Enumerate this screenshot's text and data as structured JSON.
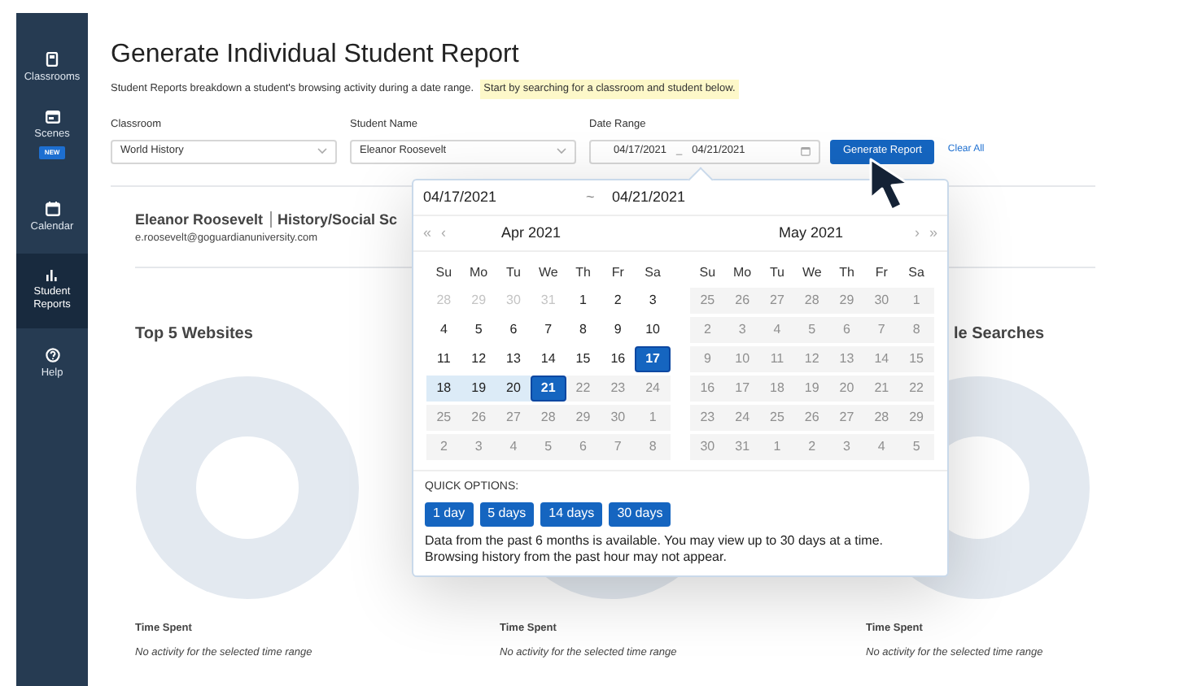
{
  "sidebar": {
    "items": [
      {
        "label": "Classrooms",
        "selected": false
      },
      {
        "label": "Scenes",
        "selected": false,
        "badge": "NEW"
      },
      {
        "label": "Calendar",
        "selected": false
      },
      {
        "label": "Student Reports",
        "selected": true
      },
      {
        "label": "Help",
        "selected": false
      }
    ]
  },
  "page": {
    "title": "Generate Individual Student Report",
    "description": "Student Reports breakdown a student's browsing activity during a date range.",
    "hint": "Start by searching for a classroom and student below."
  },
  "filters": {
    "classroom": {
      "label": "Classroom",
      "value": "World History"
    },
    "student": {
      "label": "Student Name",
      "value": "Eleanor Roosevelt"
    },
    "date_range": {
      "label": "Date Range",
      "start": "04/17/2021",
      "separator": "_",
      "end": "04/21/2021"
    },
    "generate_button": "Generate Report",
    "clear_link": "Clear All"
  },
  "student": {
    "name": "Eleanor Roosevelt",
    "subject": "History/Social Sc",
    "email": "e.roosevelt@goguardianuniversity.com"
  },
  "panels": [
    {
      "title": "Top 5 Websites",
      "metric": "Time Spent",
      "empty": "No activity for the selected time range"
    },
    {
      "metric": "Time Spent",
      "empty": "No activity for the selected time range"
    },
    {
      "title": "le Searches",
      "metric": "Time Spent",
      "empty": "No activity for the selected time range"
    }
  ],
  "date_picker": {
    "start": "04/17/2021",
    "separator": "~",
    "end": "04/21/2021",
    "nav_prev_year": "«",
    "nav_prev": "‹",
    "nav_next": "›",
    "nav_next_year": "»",
    "months": [
      {
        "title": "Apr 2021",
        "weekdays": [
          "Su",
          "Mo",
          "Tu",
          "We",
          "Th",
          "Fr",
          "Sa"
        ],
        "weeks": [
          [
            {
              "day": "28",
              "kind": "outside"
            },
            {
              "day": "29",
              "kind": "outside"
            },
            {
              "day": "30",
              "kind": "outside"
            },
            {
              "day": "31",
              "kind": "outside"
            },
            {
              "day": "1",
              "kind": "normal"
            },
            {
              "day": "2",
              "kind": "normal"
            },
            {
              "day": "3",
              "kind": "normal"
            }
          ],
          [
            {
              "day": "4",
              "kind": "normal"
            },
            {
              "day": "5",
              "kind": "normal"
            },
            {
              "day": "6",
              "kind": "normal"
            },
            {
              "day": "7",
              "kind": "normal"
            },
            {
              "day": "8",
              "kind": "normal"
            },
            {
              "day": "9",
              "kind": "normal"
            },
            {
              "day": "10",
              "kind": "normal"
            }
          ],
          [
            {
              "day": "11",
              "kind": "normal"
            },
            {
              "day": "12",
              "kind": "normal"
            },
            {
              "day": "13",
              "kind": "normal"
            },
            {
              "day": "14",
              "kind": "normal"
            },
            {
              "day": "15",
              "kind": "normal"
            },
            {
              "day": "16",
              "kind": "normal"
            },
            {
              "day": "17",
              "kind": "selected"
            }
          ],
          [
            {
              "day": "18",
              "kind": "in_range"
            },
            {
              "day": "19",
              "kind": "in_range"
            },
            {
              "day": "20",
              "kind": "in_range"
            },
            {
              "day": "21",
              "kind": "selected"
            },
            {
              "day": "22",
              "kind": "disabled"
            },
            {
              "day": "23",
              "kind": "disabled"
            },
            {
              "day": "24",
              "kind": "disabled"
            }
          ],
          [
            {
              "day": "25",
              "kind": "disabled"
            },
            {
              "day": "26",
              "kind": "disabled"
            },
            {
              "day": "27",
              "kind": "disabled"
            },
            {
              "day": "28",
              "kind": "disabled"
            },
            {
              "day": "29",
              "kind": "disabled"
            },
            {
              "day": "30",
              "kind": "disabled"
            },
            {
              "day": "1",
              "kind": "disabled"
            }
          ],
          [
            {
              "day": "2",
              "kind": "disabled"
            },
            {
              "day": "3",
              "kind": "disabled"
            },
            {
              "day": "4",
              "kind": "disabled"
            },
            {
              "day": "5",
              "kind": "disabled"
            },
            {
              "day": "6",
              "kind": "disabled"
            },
            {
              "day": "7",
              "kind": "disabled"
            },
            {
              "day": "8",
              "kind": "disabled"
            }
          ]
        ]
      },
      {
        "title": "May 2021",
        "weekdays": [
          "Su",
          "Mo",
          "Tu",
          "We",
          "Th",
          "Fr",
          "Sa"
        ],
        "weeks": [
          [
            {
              "day": "25",
              "kind": "disabled"
            },
            {
              "day": "26",
              "kind": "disabled"
            },
            {
              "day": "27",
              "kind": "disabled"
            },
            {
              "day": "28",
              "kind": "disabled"
            },
            {
              "day": "29",
              "kind": "disabled"
            },
            {
              "day": "30",
              "kind": "disabled"
            },
            {
              "day": "1",
              "kind": "disabled"
            }
          ],
          [
            {
              "day": "2",
              "kind": "disabled"
            },
            {
              "day": "3",
              "kind": "disabled"
            },
            {
              "day": "4",
              "kind": "disabled"
            },
            {
              "day": "5",
              "kind": "disabled"
            },
            {
              "day": "6",
              "kind": "disabled"
            },
            {
              "day": "7",
              "kind": "disabled"
            },
            {
              "day": "8",
              "kind": "disabled"
            }
          ],
          [
            {
              "day": "9",
              "kind": "disabled"
            },
            {
              "day": "10",
              "kind": "disabled"
            },
            {
              "day": "11",
              "kind": "disabled"
            },
            {
              "day": "12",
              "kind": "disabled"
            },
            {
              "day": "13",
              "kind": "disabled"
            },
            {
              "day": "14",
              "kind": "disabled"
            },
            {
              "day": "15",
              "kind": "disabled"
            }
          ],
          [
            {
              "day": "16",
              "kind": "disabled"
            },
            {
              "day": "17",
              "kind": "disabled"
            },
            {
              "day": "18",
              "kind": "disabled"
            },
            {
              "day": "19",
              "kind": "disabled"
            },
            {
              "day": "20",
              "kind": "disabled"
            },
            {
              "day": "21",
              "kind": "disabled"
            },
            {
              "day": "22",
              "kind": "disabled"
            }
          ],
          [
            {
              "day": "23",
              "kind": "disabled"
            },
            {
              "day": "24",
              "kind": "disabled"
            },
            {
              "day": "25",
              "kind": "disabled"
            },
            {
              "day": "26",
              "kind": "disabled"
            },
            {
              "day": "27",
              "kind": "disabled"
            },
            {
              "day": "28",
              "kind": "disabled"
            },
            {
              "day": "29",
              "kind": "disabled"
            }
          ],
          [
            {
              "day": "30",
              "kind": "disabled"
            },
            {
              "day": "31",
              "kind": "disabled"
            },
            {
              "day": "1",
              "kind": "disabled"
            },
            {
              "day": "2",
              "kind": "disabled"
            },
            {
              "day": "3",
              "kind": "disabled"
            },
            {
              "day": "4",
              "kind": "disabled"
            },
            {
              "day": "5",
              "kind": "disabled"
            }
          ]
        ]
      }
    ],
    "quick_label": "QUICK OPTIONS:",
    "quick_options": [
      "1 day",
      "5 days",
      "14 days",
      "30 days"
    ],
    "note": "Data from the past 6 months is available. You may view up to 30 days at a time. Browsing history from the past hour may not appear."
  }
}
